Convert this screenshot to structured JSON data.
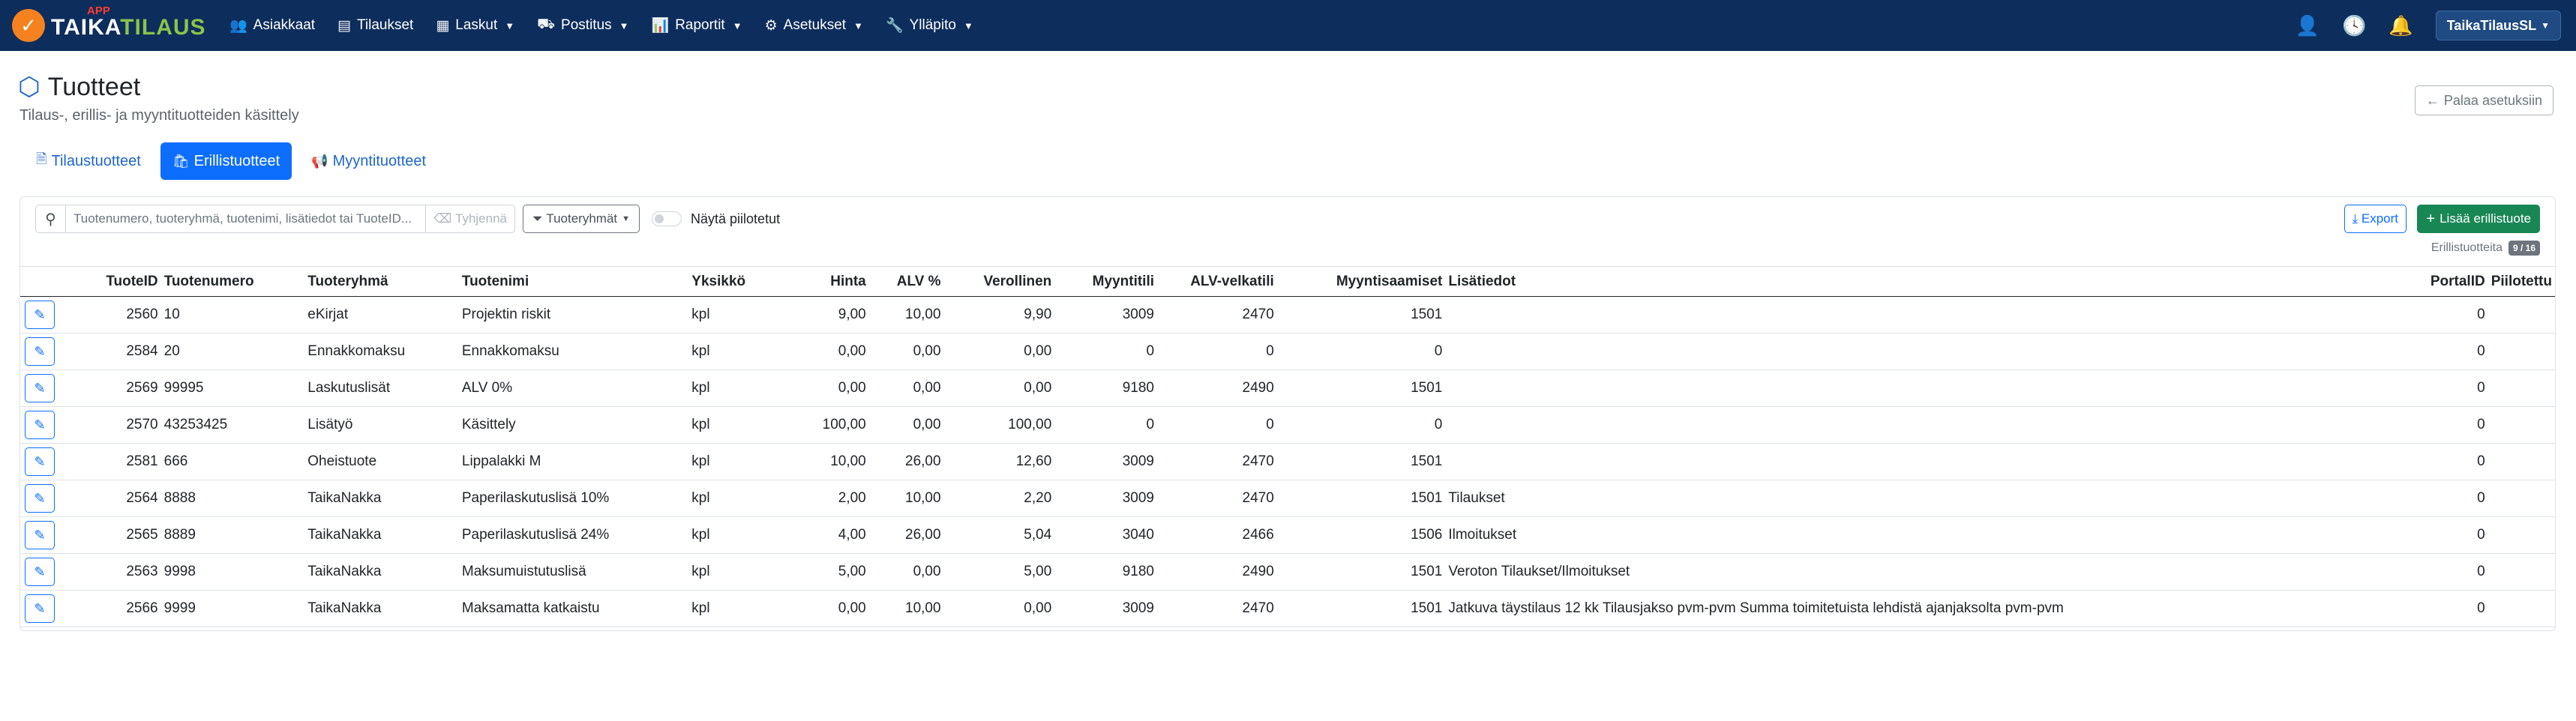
{
  "brand": {
    "name_main": "TAIKA",
    "name_accent": "TILAUS",
    "app_badge": "APP",
    "colors": {
      "navbar": "#0d2d5c",
      "logo": "#f5821f",
      "accent": "#8bc34a",
      "badge": "#ff3b30"
    }
  },
  "nav": {
    "items": [
      {
        "label": "Asiakkaat",
        "icon": "users-icon",
        "dropdown": false
      },
      {
        "label": "Tilaukset",
        "icon": "list-icon",
        "dropdown": false
      },
      {
        "label": "Laskut",
        "icon": "invoice-icon",
        "dropdown": true
      },
      {
        "label": "Postitus",
        "icon": "truck-icon",
        "dropdown": true
      },
      {
        "label": "Raportit",
        "icon": "chart-icon",
        "dropdown": true
      },
      {
        "label": "Asetukset",
        "icon": "gear-icon",
        "dropdown": true
      },
      {
        "label": "Ylläpito",
        "icon": "wrench-icon",
        "dropdown": true
      }
    ],
    "user": "TaikaTilausSL"
  },
  "header": {
    "title": "Tuotteet",
    "subtitle": "Tilaus-, erillis- ja myyntituotteiden käsittely",
    "back_label": "Palaa asetuksiin"
  },
  "tabs": [
    {
      "label": "Tilaustuotteet",
      "active": false
    },
    {
      "label": "Erillistuotteet",
      "active": true
    },
    {
      "label": "Myyntituotteet",
      "active": false
    }
  ],
  "toolbar": {
    "search_placeholder": "Tuotenumero, tuoteryhmä, tuotenimi, lisätiedot tai TuoteID...",
    "search_value": "",
    "clear_label": "Tyhjennä",
    "group_filter_label": "Tuoteryhmät",
    "show_hidden_label": "Näytä piilotetut",
    "show_hidden": false,
    "export_label": "Export",
    "add_label": "Lisää erillistuote",
    "count_label": "Erillistuotteita",
    "count_value": "9 / 16"
  },
  "table": {
    "headers": [
      "",
      "TuoteID",
      "Tuotenumero",
      "Tuoteryhmä",
      "Tuotenimi",
      "Yksikkö",
      "Hinta",
      "ALV %",
      "Verollinen",
      "Myyntitili",
      "ALV-velkatili",
      "Myyntisaamiset",
      "Lisätiedot",
      "PortalID",
      "Piilotettu"
    ],
    "rows": [
      [
        "2560",
        "10",
        "eKirjat",
        "Projektin riskit",
        "kpl",
        "9,00",
        "10,00",
        "9,90",
        "3009",
        "2470",
        "1501",
        "",
        "0",
        ""
      ],
      [
        "2584",
        "20",
        "Ennakkomaksu",
        "Ennakkomaksu",
        "kpl",
        "0,00",
        "0,00",
        "0,00",
        "0",
        "0",
        "0",
        "",
        "0",
        ""
      ],
      [
        "2569",
        "99995",
        "Laskutuslisät",
        "ALV 0%",
        "kpl",
        "0,00",
        "0,00",
        "0,00",
        "9180",
        "2490",
        "1501",
        "",
        "0",
        ""
      ],
      [
        "2570",
        "43253425",
        "Lisätyö",
        "Käsittely",
        "kpl",
        "100,00",
        "0,00",
        "100,00",
        "0",
        "0",
        "0",
        "",
        "0",
        ""
      ],
      [
        "2581",
        "666",
        "Oheistuote",
        "Lippalakki M",
        "kpl",
        "10,00",
        "26,00",
        "12,60",
        "3009",
        "2470",
        "1501",
        "",
        "0",
        ""
      ],
      [
        "2564",
        "8888",
        "TaikaNakka",
        "Paperilaskutuslisä 10%",
        "kpl",
        "2,00",
        "10,00",
        "2,20",
        "3009",
        "2470",
        "1501",
        "Tilaukset",
        "0",
        ""
      ],
      [
        "2565",
        "8889",
        "TaikaNakka",
        "Paperilaskutuslisä 24%",
        "kpl",
        "4,00",
        "26,00",
        "5,04",
        "3040",
        "2466",
        "1506",
        "Ilmoitukset",
        "0",
        ""
      ],
      [
        "2563",
        "9998",
        "TaikaNakka",
        "Maksumuistutuslisä",
        "kpl",
        "5,00",
        "0,00",
        "5,00",
        "9180",
        "2490",
        "1501",
        "Veroton Tilaukset/Ilmoitukset",
        "0",
        ""
      ],
      [
        "2566",
        "9999",
        "TaikaNakka",
        "Maksamatta katkaistu",
        "kpl",
        "0,00",
        "10,00",
        "0,00",
        "3009",
        "2470",
        "1501",
        "Jatkuva täystilaus 12 kk Tilausjakso pvm-pvm Summa toimitetuista lehdistä ajanjaksolta pvm-pvm",
        "0",
        ""
      ]
    ]
  }
}
